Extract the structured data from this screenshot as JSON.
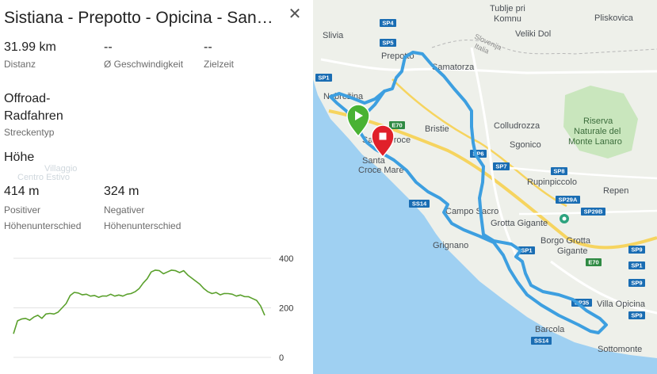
{
  "panel": {
    "title": "Sistiana - Prepotto - Opicina - San…",
    "ghost_labels": [
      "Villaggio",
      "Centro Estivo"
    ],
    "stats": {
      "distance": {
        "value": "31.99 km",
        "label": "Distanz"
      },
      "speed": {
        "value": "--",
        "label": "Ø Geschwindigkeit"
      },
      "target_time": {
        "value": "--",
        "label": "Zielzeit"
      },
      "track_type": {
        "value_line1": "Offroad-",
        "value_line2": "Radfahren",
        "label": "Streckentyp"
      }
    },
    "elevation_header": "Höhe",
    "ascent": {
      "value": "414 m",
      "label_line1": "Positiver",
      "label_line2": "Höhenunterschied"
    },
    "descent": {
      "value": "324 m",
      "label_line1": "Negativer",
      "label_line2": "Höhenunterschied"
    },
    "close_icon": "close-icon"
  },
  "chart_data": {
    "type": "area",
    "title": "",
    "xlabel": "",
    "ylabel": "",
    "y_ticks": [
      "400",
      "200",
      "0"
    ],
    "ylim": [
      0,
      400
    ],
    "grid": true,
    "line_color": "#5aa02c",
    "series": [
      {
        "values": [
          95,
          150,
          155,
          160,
          150,
          165,
          170,
          160,
          175,
          180,
          175,
          185,
          200,
          220,
          250,
          265,
          260,
          255,
          255,
          250,
          250,
          245,
          248,
          250,
          255,
          250,
          252,
          250,
          255,
          260,
          265,
          280,
          300,
          320,
          345,
          355,
          350,
          340,
          345,
          355,
          350,
          345,
          350,
          335,
          320,
          310,
          295,
          280,
          265,
          260,
          262,
          255,
          258,
          260,
          255,
          250,
          252,
          248,
          245,
          240,
          230,
          210,
          170
        ]
      }
    ]
  },
  "map": {
    "labels": [
      "Tublje pri",
      "Komnu",
      "Slivia",
      "Veliki Dol",
      "Pliskovica",
      "Slovenija",
      "Italia",
      "Prepotto",
      "Samatorza",
      "Nabrežina",
      "Bristie",
      "Colludrozza",
      "Sgonico",
      "Riserva",
      "Naturale del",
      "Monte Lanaro",
      "Santa Croce",
      "Santa",
      "Croce Mare",
      "Rupinpiccolo",
      "Repen",
      "Campo Sacro",
      "Grotta Gigante",
      "Borgo Grotta",
      "Gigante",
      "Grignano",
      "Villa Opicina",
      "Barcola",
      "Sottomonte"
    ],
    "road_shields": [
      "SP4",
      "SP5",
      "SP1",
      "E70",
      "SP6",
      "SP7",
      "SP8",
      "SP29A",
      "SP29B",
      "SS14",
      "SP1",
      "E70",
      "SP9",
      "SP35",
      "SS14",
      "SP1",
      "SP9",
      "SP9"
    ],
    "route_color": "#3d9fe0",
    "start_icon": "play-marker-icon",
    "end_icon": "stop-marker-icon",
    "colors": {
      "sea": "#9fd0f2",
      "land": "#eef0ea",
      "park": "#c9e6bd",
      "road_major": "#f6d45f"
    }
  }
}
